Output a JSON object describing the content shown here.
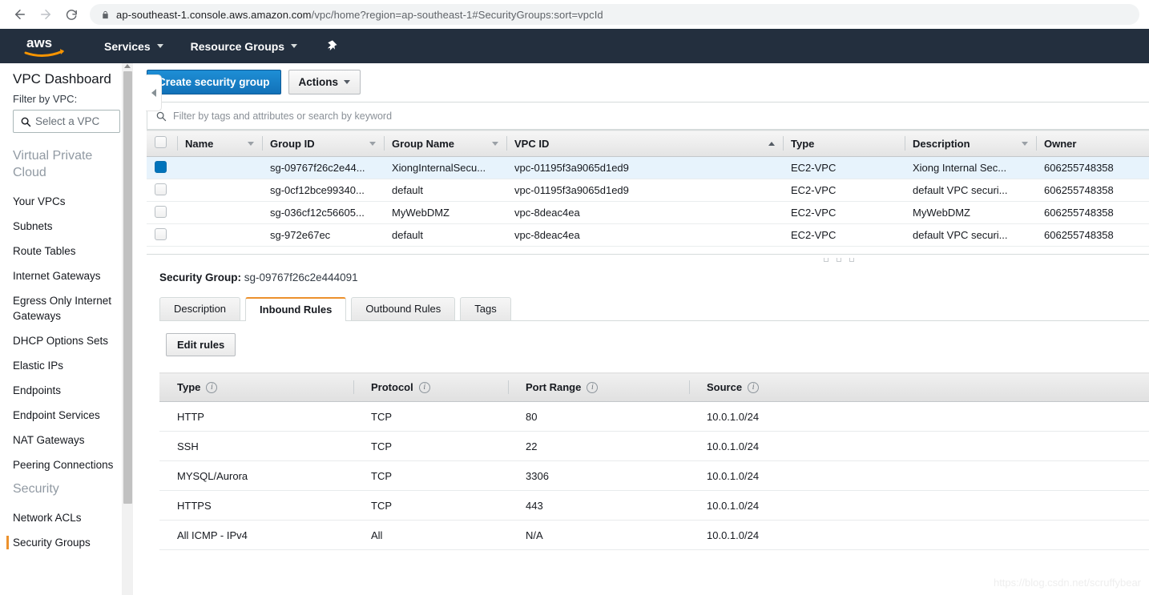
{
  "browser": {
    "back_icon": "back-arrow-icon",
    "forward_icon": "forward-arrow-icon",
    "reload_icon": "reload-icon",
    "lock_icon": "lock-icon",
    "url_host": "ap-southeast-1.console.aws.amazon.com",
    "url_path": "/vpc/home?region=ap-southeast-1#SecurityGroups:sort=vpcId",
    "url_full": "ap-southeast-1.console.aws.amazon.com/vpc/home?region=ap-southeast-1#SecurityGroups:sort=vpcId"
  },
  "topnav": {
    "logo": "aws",
    "services_label": "Services",
    "resource_groups_label": "Resource Groups",
    "pin_icon": "pin-icon",
    "bg_color": "#232f3e"
  },
  "sidebar": {
    "title": "VPC Dashboard",
    "filter_label": "Filter by VPC:",
    "vpc_select_placeholder": "Select a VPC",
    "search_icon": "search-icon",
    "groups": [
      {
        "label": "Virtual Private Cloud",
        "items": [
          "Your VPCs",
          "Subnets",
          "Route Tables",
          "Internet Gateways",
          "Egress Only Internet Gateways",
          "DHCP Options Sets",
          "Elastic IPs",
          "Endpoints",
          "Endpoint Services",
          "NAT Gateways",
          "Peering Connections"
        ]
      },
      {
        "label": "Security",
        "items": [
          "Network ACLs",
          "Security Groups"
        ]
      }
    ],
    "active_item": "Security Groups",
    "active_marker_color": "#ec912d",
    "collapse_icon": "chevron-left-icon"
  },
  "toolbar": {
    "create_label": "Create security group",
    "create_color": "#1978c7",
    "actions_label": "Actions",
    "actions_caret": "chevron-down-icon"
  },
  "filter": {
    "placeholder": "Filter by tags and attributes or search by keyword",
    "search_icon": "search-icon"
  },
  "resource_table": {
    "columns": [
      {
        "label": "Name",
        "caret": "down"
      },
      {
        "label": "Group ID",
        "caret": "down"
      },
      {
        "label": "Group Name",
        "caret": "down"
      },
      {
        "label": "VPC ID",
        "caret": "up"
      },
      {
        "label": "Type",
        "caret": "none"
      },
      {
        "label": "Description",
        "caret": "down"
      },
      {
        "label": "Owner",
        "caret": "none"
      }
    ],
    "rows": [
      {
        "selected": true,
        "name": "",
        "group_id": "sg-09767f26c2e44...",
        "group_name": "XiongInternalSecu...",
        "vpc_id": "vpc-01195f3a9065d1ed9",
        "type": "EC2-VPC",
        "description": "Xiong Internal Sec...",
        "owner": "606255748358"
      },
      {
        "selected": false,
        "name": "",
        "group_id": "sg-0cf12bce99340...",
        "group_name": "default",
        "vpc_id": "vpc-01195f3a9065d1ed9",
        "type": "EC2-VPC",
        "description": "default VPC securi...",
        "owner": "606255748358"
      },
      {
        "selected": false,
        "name": "",
        "group_id": "sg-036cf12c56605...",
        "group_name": "MyWebDMZ",
        "vpc_id": "vpc-8deac4ea",
        "type": "EC2-VPC",
        "description": "MyWebDMZ",
        "owner": "606255748358"
      },
      {
        "selected": false,
        "name": "",
        "group_id": "sg-972e67ec",
        "group_name": "default",
        "vpc_id": "vpc-8deac4ea",
        "type": "EC2-VPC",
        "description": "default VPC securi...",
        "owner": "606255748358"
      }
    ]
  },
  "detail": {
    "label": "Security Group:",
    "value": "sg-09767f26c2e444091",
    "tabs": [
      {
        "label": "Description",
        "active": false
      },
      {
        "label": "Inbound Rules",
        "active": true
      },
      {
        "label": "Outbound Rules",
        "active": false
      },
      {
        "label": "Tags",
        "active": false
      }
    ],
    "edit_rules_label": "Edit rules",
    "rules_columns": [
      {
        "label": "Type",
        "info": "info-icon"
      },
      {
        "label": "Protocol",
        "info": "info-icon"
      },
      {
        "label": "Port Range",
        "info": "info-icon"
      },
      {
        "label": "Source",
        "info": "info-icon"
      }
    ],
    "rules": [
      {
        "type": "HTTP",
        "protocol": "TCP",
        "port_range": "80",
        "source": "10.0.1.0/24"
      },
      {
        "type": "SSH",
        "protocol": "TCP",
        "port_range": "22",
        "source": "10.0.1.0/24"
      },
      {
        "type": "MYSQL/Aurora",
        "protocol": "TCP",
        "port_range": "3306",
        "source": "10.0.1.0/24"
      },
      {
        "type": "HTTPS",
        "protocol": "TCP",
        "port_range": "443",
        "source": "10.0.1.0/24"
      },
      {
        "type": "All ICMP - IPv4",
        "protocol": "All",
        "port_range": "N/A",
        "source": "10.0.1.0/24"
      }
    ]
  },
  "watermark": "https://blog.csdn.net/scruffybear"
}
